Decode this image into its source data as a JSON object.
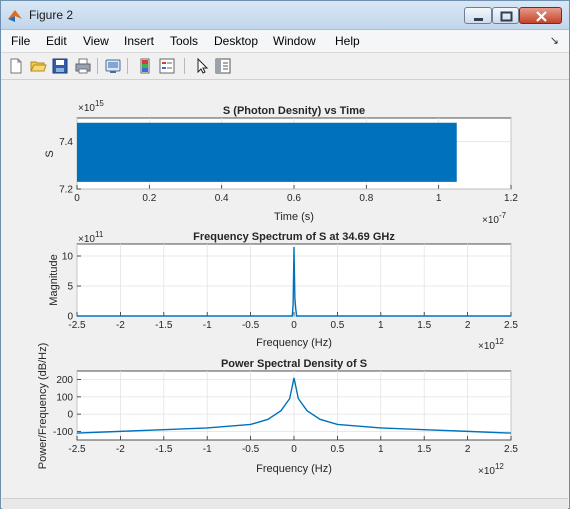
{
  "window": {
    "title": "Figure 2"
  },
  "menu": {
    "items": [
      "File",
      "Edit",
      "View",
      "Insert",
      "Tools",
      "Desktop",
      "Window",
      "Help"
    ],
    "overflow_arrow": "↘"
  },
  "toolbar": {
    "icons": [
      "new-figure-icon",
      "open-file-icon",
      "save-icon",
      "print-icon",
      "link-plot-icon",
      "insert-colorbar-icon",
      "insert-legend-icon",
      "edit-plot-arrow-icon",
      "property-inspector-icon"
    ]
  },
  "plots": {
    "top": {
      "title": "S (Photon Desnity) vs Time",
      "xlabel": "Time (s)",
      "ylabel": "S",
      "x_exponent_base": "×10",
      "x_exponent_power": "-7",
      "y_exponent_base": "×10",
      "y_exponent_power": "15"
    },
    "mid": {
      "title": "Frequency Spectrum of S at 34.69 GHz",
      "xlabel": "Frequency (Hz)",
      "ylabel": "Magnitude",
      "x_exponent_base": "×10",
      "x_exponent_power": "12",
      "y_exponent_base": "×10",
      "y_exponent_power": "11"
    },
    "bot": {
      "title": "Power Spectral Density of S",
      "xlabel": "Frequency (Hz)",
      "ylabel": "Power/Frequency (dB/Hz)",
      "x_exponent_base": "×10",
      "x_exponent_power": "12"
    }
  },
  "chart_data": [
    {
      "type": "area",
      "title": "S (Photon Desnity) vs Time",
      "xlabel": "Time (s)",
      "ylabel": "S",
      "x_scale_note": "×10^-7",
      "y_scale_note": "×10^15",
      "xlim": [
        0,
        1.2
      ],
      "ylim": [
        7.2,
        7.5
      ],
      "xticks": [
        "0",
        "0.2",
        "0.4",
        "0.6",
        "0.8",
        "1",
        "1.2"
      ],
      "yticks": [
        "7.2",
        "7.4"
      ],
      "grid": true,
      "color": "#0072bd",
      "series": [
        {
          "x": [
            0,
            1.05
          ],
          "y_low": [
            7.23,
            7.23
          ],
          "y_high": [
            7.48,
            7.48
          ]
        }
      ]
    },
    {
      "type": "line",
      "title": "Frequency Spectrum of S at 34.69 GHz",
      "xlabel": "Frequency (Hz)",
      "ylabel": "Magnitude",
      "x_scale_note": "×10^12",
      "y_scale_note": "×10^11",
      "xlim": [
        -2.5,
        2.5
      ],
      "ylim": [
        0,
        12
      ],
      "xticks": [
        "-2.5",
        "-2",
        "-1.5",
        "-1",
        "-0.5",
        "0",
        "0.5",
        "1",
        "1.5",
        "2",
        "2.5"
      ],
      "yticks": [
        "0",
        "5",
        "10"
      ],
      "grid": true,
      "color": "#0072bd",
      "series": [
        {
          "x": [
            -2.5,
            -0.02,
            -0.01,
            0,
            0.01,
            0.02,
            0.03,
            2.5
          ],
          "y": [
            0,
            0,
            2,
            11.5,
            3,
            1.2,
            0,
            0
          ]
        }
      ]
    },
    {
      "type": "line",
      "title": "Power Spectral Density of S",
      "xlabel": "Frequency (Hz)",
      "ylabel": "Power/Frequency (dB/Hz)",
      "x_scale_note": "×10^12",
      "xlim": [
        -2.5,
        2.5
      ],
      "ylim": [
        -150,
        250
      ],
      "xticks": [
        "-2.5",
        "-2",
        "-1.5",
        "-1",
        "-0.5",
        "0",
        "0.5",
        "1",
        "1.5",
        "2",
        "2.5"
      ],
      "yticks": [
        "-100",
        "0",
        "100",
        "200"
      ],
      "grid": true,
      "color": "#0072bd",
      "series": [
        {
          "x": [
            -2.5,
            -2.0,
            -1.5,
            -1.0,
            -0.5,
            -0.3,
            -0.15,
            -0.05,
            0,
            0.05,
            0.15,
            0.3,
            0.5,
            1.0,
            1.5,
            2.0,
            2.5
          ],
          "y": [
            -110,
            -100,
            -90,
            -80,
            -60,
            -30,
            20,
            90,
            210,
            90,
            20,
            -30,
            -60,
            -80,
            -90,
            -100,
            -110
          ]
        }
      ]
    }
  ]
}
